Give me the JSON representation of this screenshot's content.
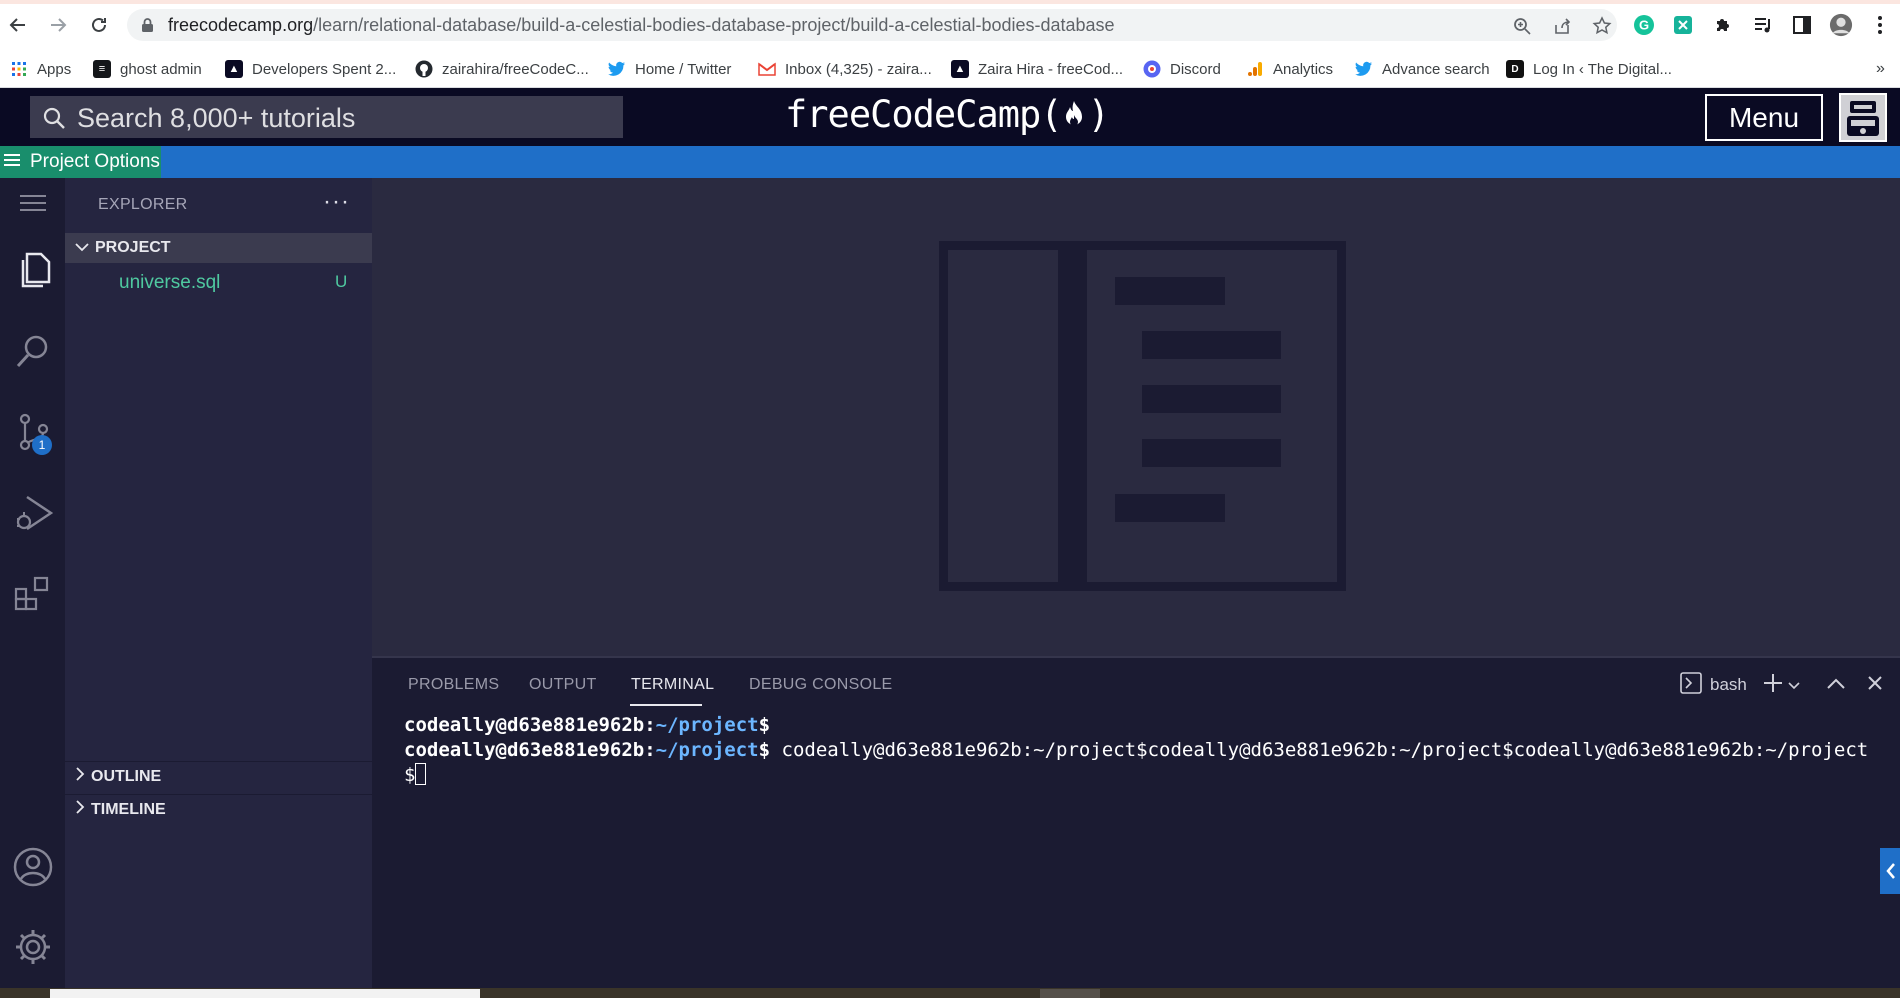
{
  "browser": {
    "url_domain": "freecodecamp.org",
    "url_path": "/learn/relational-database/build-a-celestial-bodies-database-project/build-a-celestial-bodies-database",
    "bookmarks": [
      {
        "label": "Apps",
        "icon": "apps-grid-icon"
      },
      {
        "label": "ghost admin",
        "icon": "ghost-icon"
      },
      {
        "label": "Developers Spent 2...",
        "icon": "fcc-icon"
      },
      {
        "label": "zairahira/freeCodeC...",
        "icon": "github-icon"
      },
      {
        "label": "Home / Twitter",
        "icon": "twitter-icon"
      },
      {
        "label": "Inbox (4,325) - zaira...",
        "icon": "gmail-icon"
      },
      {
        "label": "Zaira Hira - freeCod...",
        "icon": "fcc-icon"
      },
      {
        "label": "Discord",
        "icon": "discord-icon"
      },
      {
        "label": "Analytics",
        "icon": "analytics-icon"
      },
      {
        "label": "Advance search",
        "icon": "twitter-icon"
      },
      {
        "label": "Log In ‹ The Digital...",
        "icon": "login-icon"
      }
    ],
    "more_bookmarks": "»"
  },
  "fcc_nav": {
    "search_placeholder": "Search 8,000+ tutorials",
    "logo_text": "freeCodeCamp(",
    "logo_close": ")",
    "menu_label": "Menu",
    "options_label": "Project Options"
  },
  "explorer": {
    "title": "EXPLORER",
    "more": "···",
    "project_label": "PROJECT",
    "file_name": "universe.sql",
    "file_status": "U",
    "outline_label": "OUTLINE",
    "timeline_label": "TIMELINE",
    "scm_badge": "1"
  },
  "panel": {
    "tabs": [
      "PROBLEMS",
      "OUTPUT",
      "TERMINAL",
      "DEBUG CONSOLE"
    ],
    "active_tab": "TERMINAL",
    "shell_label": "bash"
  },
  "terminal": {
    "line1_user": "codeally@d63e881e962b",
    "line1_path": "~/project",
    "line1_prompt": "$",
    "line2_user": "codeally@d63e881e962b",
    "line2_path": "~/project",
    "line2_prompt": "$",
    "line2_rest": " codeally@d63e881e962b:~/project$codeally@d63e881e962b:~/project$codeally@d63e881e962b:~/project$"
  },
  "colors": {
    "fcc_dark": "#0a0a23",
    "options_blue": "#1f6fc8",
    "options_green": "#198e6c",
    "sidebar_bg": "#252540",
    "file_green": "#4fc9a0"
  }
}
